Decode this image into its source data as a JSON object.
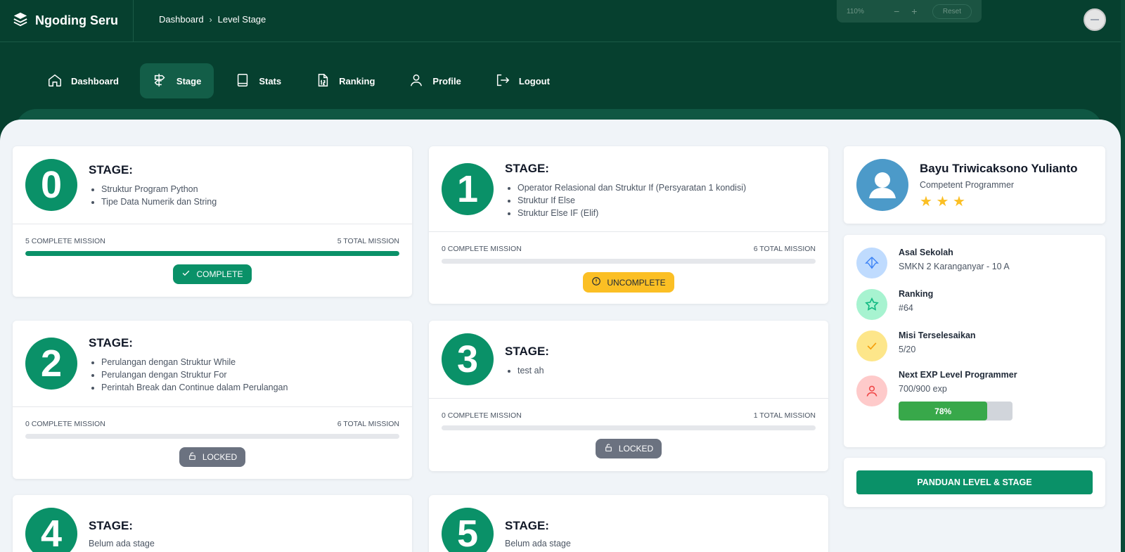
{
  "app": {
    "title": "Ngoding Seru"
  },
  "breadcrumb": {
    "items": [
      "Dashboard",
      "Level Stage"
    ]
  },
  "zoom": {
    "value": "110%",
    "minus": "−",
    "plus": "+",
    "reset": "Reset"
  },
  "nav": {
    "items": [
      {
        "label": "Dashboard",
        "icon": "home-icon"
      },
      {
        "label": "Stage",
        "icon": "signpost-icon",
        "active": true
      },
      {
        "label": "Stats",
        "icon": "book-icon"
      },
      {
        "label": "Ranking",
        "icon": "ranking-icon"
      },
      {
        "label": "Profile",
        "icon": "user-icon"
      },
      {
        "label": "Logout",
        "icon": "logout-icon"
      }
    ]
  },
  "stages": [
    {
      "number": "0",
      "title": "STAGE:",
      "topics": [
        "Struktur Program Python",
        "Tipe Data Numerik dan String"
      ],
      "complete_label": "5 COMPLETE MISSION",
      "total_label": "5 TOTAL MISSION",
      "progress": 1.0,
      "status": "COMPLETE"
    },
    {
      "number": "1",
      "title": "STAGE:",
      "topics": [
        "Operator Relasional dan Struktur If (Persyaratan 1 kondisi)",
        "Struktur If Else",
        "Struktur Else IF (Elif)"
      ],
      "complete_label": "0 COMPLETE MISSION",
      "total_label": "6 TOTAL MISSION",
      "progress": 0,
      "status": "UNCOMPLETE"
    },
    {
      "number": "2",
      "title": "STAGE:",
      "topics": [
        "Perulangan dengan Struktur While",
        "Perulangan dengan Struktur For",
        "Perintah Break dan Continue dalam Perulangan"
      ],
      "complete_label": "0 COMPLETE MISSION",
      "total_label": "6 TOTAL MISSION",
      "progress": 0,
      "status": "LOCKED"
    },
    {
      "number": "3",
      "title": "STAGE:",
      "topics": [
        "test ah"
      ],
      "complete_label": "0 COMPLETE MISSION",
      "total_label": "1 TOTAL MISSION",
      "progress": 0,
      "status": "LOCKED"
    },
    {
      "number": "4",
      "title": "STAGE:",
      "empty": "Belum ada stage"
    },
    {
      "number": "5",
      "title": "STAGE:",
      "empty": "Belum ada stage"
    }
  ],
  "profile": {
    "name": "Bayu Triwicaksono Yulianto",
    "role": "Competent Programmer",
    "stars": "★ ★ ★",
    "stars_count": 3
  },
  "info": {
    "school": {
      "label": "Asal Sekolah",
      "value": "SMKN 2 Karanganyar - 10 A"
    },
    "ranking": {
      "label": "Ranking",
      "value": "#64"
    },
    "missions": {
      "label": "Misi Terselesaikan",
      "value": "5/20"
    },
    "exp": {
      "label": "Next EXP Level Programmer",
      "value": "700/900 exp",
      "percent_label": "78%",
      "percent": 78
    }
  },
  "guide_button": "PANDUAN LEVEL & STAGE",
  "colors": {
    "primary": "#06402f",
    "accent": "#0a9168",
    "warning": "#fbbf24",
    "locked": "#6b7280",
    "background": "#f0f4f8"
  }
}
